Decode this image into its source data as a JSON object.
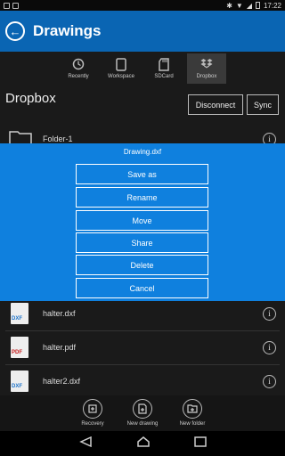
{
  "status": {
    "time": "17:22"
  },
  "appbar": {
    "title": "Drawings"
  },
  "tabs": [
    {
      "label": "Recently",
      "icon": "clock-icon"
    },
    {
      "label": "Workspace",
      "icon": "tablet-icon"
    },
    {
      "label": "SDCard",
      "icon": "sdcard-icon"
    },
    {
      "label": "Dropbox",
      "icon": "dropbox-icon"
    }
  ],
  "section": {
    "title": "Dropbox",
    "disconnect": "Disconnect",
    "sync": "Sync"
  },
  "files": [
    {
      "name": "Folder-1",
      "type": "folder"
    },
    {
      "name": "halter.dxf",
      "type": "DXF"
    },
    {
      "name": "halter.pdf",
      "type": "PDF"
    },
    {
      "name": "halter2.dxf",
      "type": "DXF"
    }
  ],
  "dialog": {
    "title": "Drawing.dxf",
    "buttons": [
      "Save as",
      "Rename",
      "Move",
      "Share",
      "Delete",
      "Cancel"
    ]
  },
  "bottom": [
    {
      "label": "Recovery",
      "icon": "recovery-icon"
    },
    {
      "label": "New drawing",
      "icon": "new-drawing-icon"
    },
    {
      "label": "New folder",
      "icon": "new-folder-icon"
    }
  ],
  "colors": {
    "appbar": "#0a65b3",
    "dialog": "#0f80de",
    "background": "#1a1a1a"
  }
}
